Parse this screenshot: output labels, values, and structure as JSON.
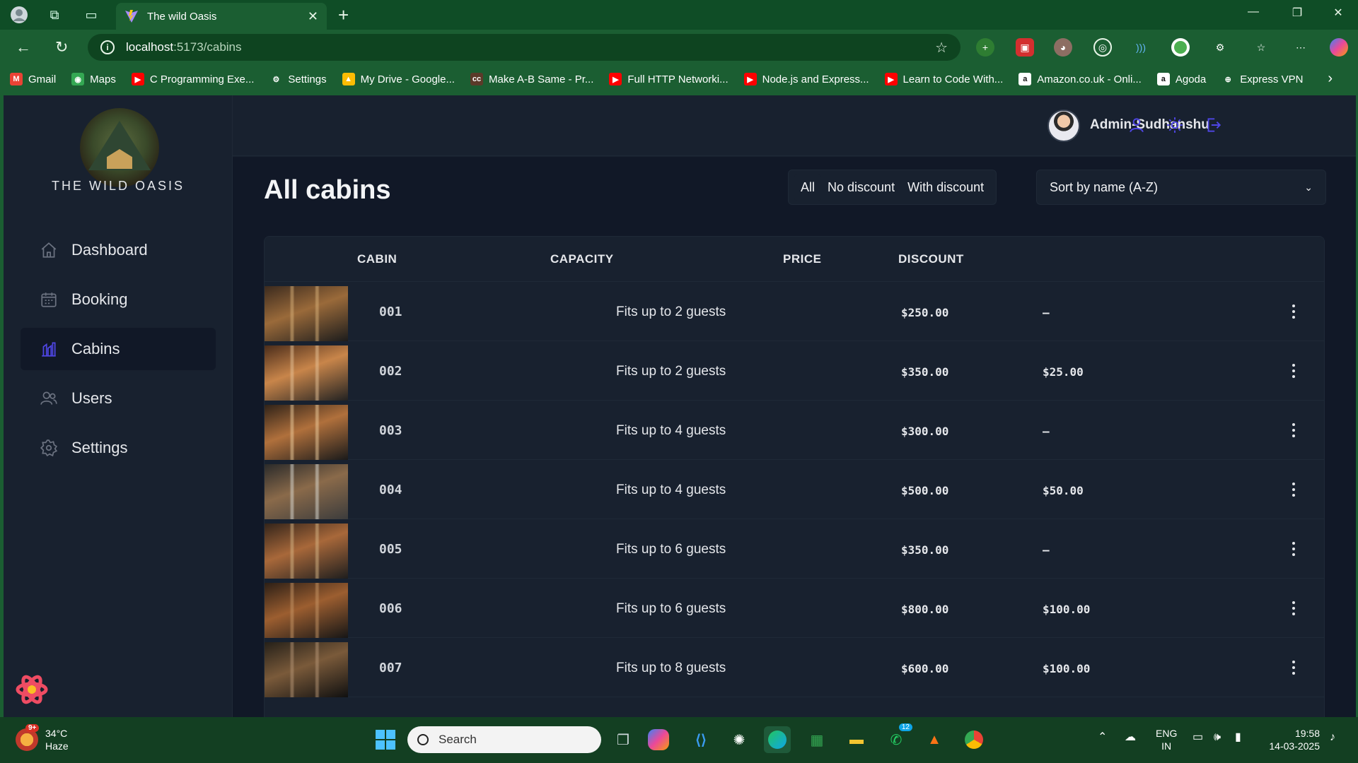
{
  "browser": {
    "tab_title": "The wild Oasis",
    "url_host": "localhost",
    "url_path": ":5173/cabins",
    "bookmarks": [
      {
        "label": "Gmail",
        "icon": "gmail-icon",
        "color": "#ea4335",
        "glyph": "M"
      },
      {
        "label": "Maps",
        "icon": "maps-icon",
        "color": "#34a853",
        "glyph": "◉"
      },
      {
        "label": "C Programming Exe...",
        "icon": "youtube-icon",
        "color": "#ff0000",
        "glyph": "▶"
      },
      {
        "label": "Settings",
        "icon": "gear-icon",
        "color": "transparent",
        "glyph": "⚙"
      },
      {
        "label": "My Drive - Google...",
        "icon": "drive-icon",
        "color": "#fbbc04",
        "glyph": "▲"
      },
      {
        "label": "Make A-B Same - Pr...",
        "icon": "codechef-icon",
        "color": "#5b3a29",
        "glyph": "cc"
      },
      {
        "label": "Full HTTP Networki...",
        "icon": "youtube-icon",
        "color": "#ff0000",
        "glyph": "▶"
      },
      {
        "label": "Node.js and Express...",
        "icon": "youtube-icon",
        "color": "#ff0000",
        "glyph": "▶"
      },
      {
        "label": "Learn to Code With...",
        "icon": "youtube-icon",
        "color": "#ff0000",
        "glyph": "▶"
      },
      {
        "label": "Amazon.co.uk - Onli...",
        "icon": "amazon-icon",
        "color": "#ffffff",
        "glyph": "a"
      },
      {
        "label": "Agoda",
        "icon": "agoda-icon",
        "color": "#ffffff",
        "glyph": "a"
      },
      {
        "label": "Express VPN",
        "icon": "globe-icon",
        "color": "transparent",
        "glyph": "⊕"
      }
    ]
  },
  "sidebar": {
    "brand": "THE WILD OASIS",
    "items": [
      {
        "label": "Dashboard",
        "icon": "home-icon",
        "active": false
      },
      {
        "label": "Booking",
        "icon": "calendar-icon",
        "active": false
      },
      {
        "label": "Cabins",
        "icon": "cabins-icon",
        "active": true
      },
      {
        "label": "Users",
        "icon": "users-icon",
        "active": false
      },
      {
        "label": "Settings",
        "icon": "settings-icon",
        "active": false
      }
    ]
  },
  "header": {
    "username": "Admin-Sudhanshu"
  },
  "main": {
    "title": "All cabins",
    "filters": [
      "All",
      "No discount",
      "With discount"
    ],
    "active_filter": "All",
    "sort_label": "Sort by name (A-Z)",
    "columns": [
      "CABIN",
      "CAPACITY",
      "PRICE",
      "DISCOUNT"
    ],
    "rows": [
      {
        "name": "001",
        "capacity": "Fits up to 2 guests",
        "price": "$250.00",
        "discount": "—"
      },
      {
        "name": "002",
        "capacity": "Fits up to 2 guests",
        "price": "$350.00",
        "discount": "$25.00"
      },
      {
        "name": "003",
        "capacity": "Fits up to 4 guests",
        "price": "$300.00",
        "discount": "—"
      },
      {
        "name": "004",
        "capacity": "Fits up to 4 guests",
        "price": "$500.00",
        "discount": "$50.00"
      },
      {
        "name": "005",
        "capacity": "Fits up to 6 guests",
        "price": "$350.00",
        "discount": "—"
      },
      {
        "name": "006",
        "capacity": "Fits up to 6 guests",
        "price": "$800.00",
        "discount": "$100.00"
      },
      {
        "name": "007",
        "capacity": "Fits up to 8 guests",
        "price": "$600.00",
        "discount": "$100.00"
      }
    ]
  },
  "taskbar": {
    "weather_temp": "34°C",
    "weather_desc": "Haze",
    "weather_badge": "9+",
    "search_label": "Search",
    "whatsapp_badge": "12",
    "lang_top": "ENG",
    "lang_bottom": "IN",
    "time": "19:58",
    "date": "14-03-2025"
  },
  "colors": {
    "accent": "#4f46e5",
    "app_bg": "#18212f",
    "main_bg": "#111827",
    "browser_green": "#1b5e32"
  }
}
